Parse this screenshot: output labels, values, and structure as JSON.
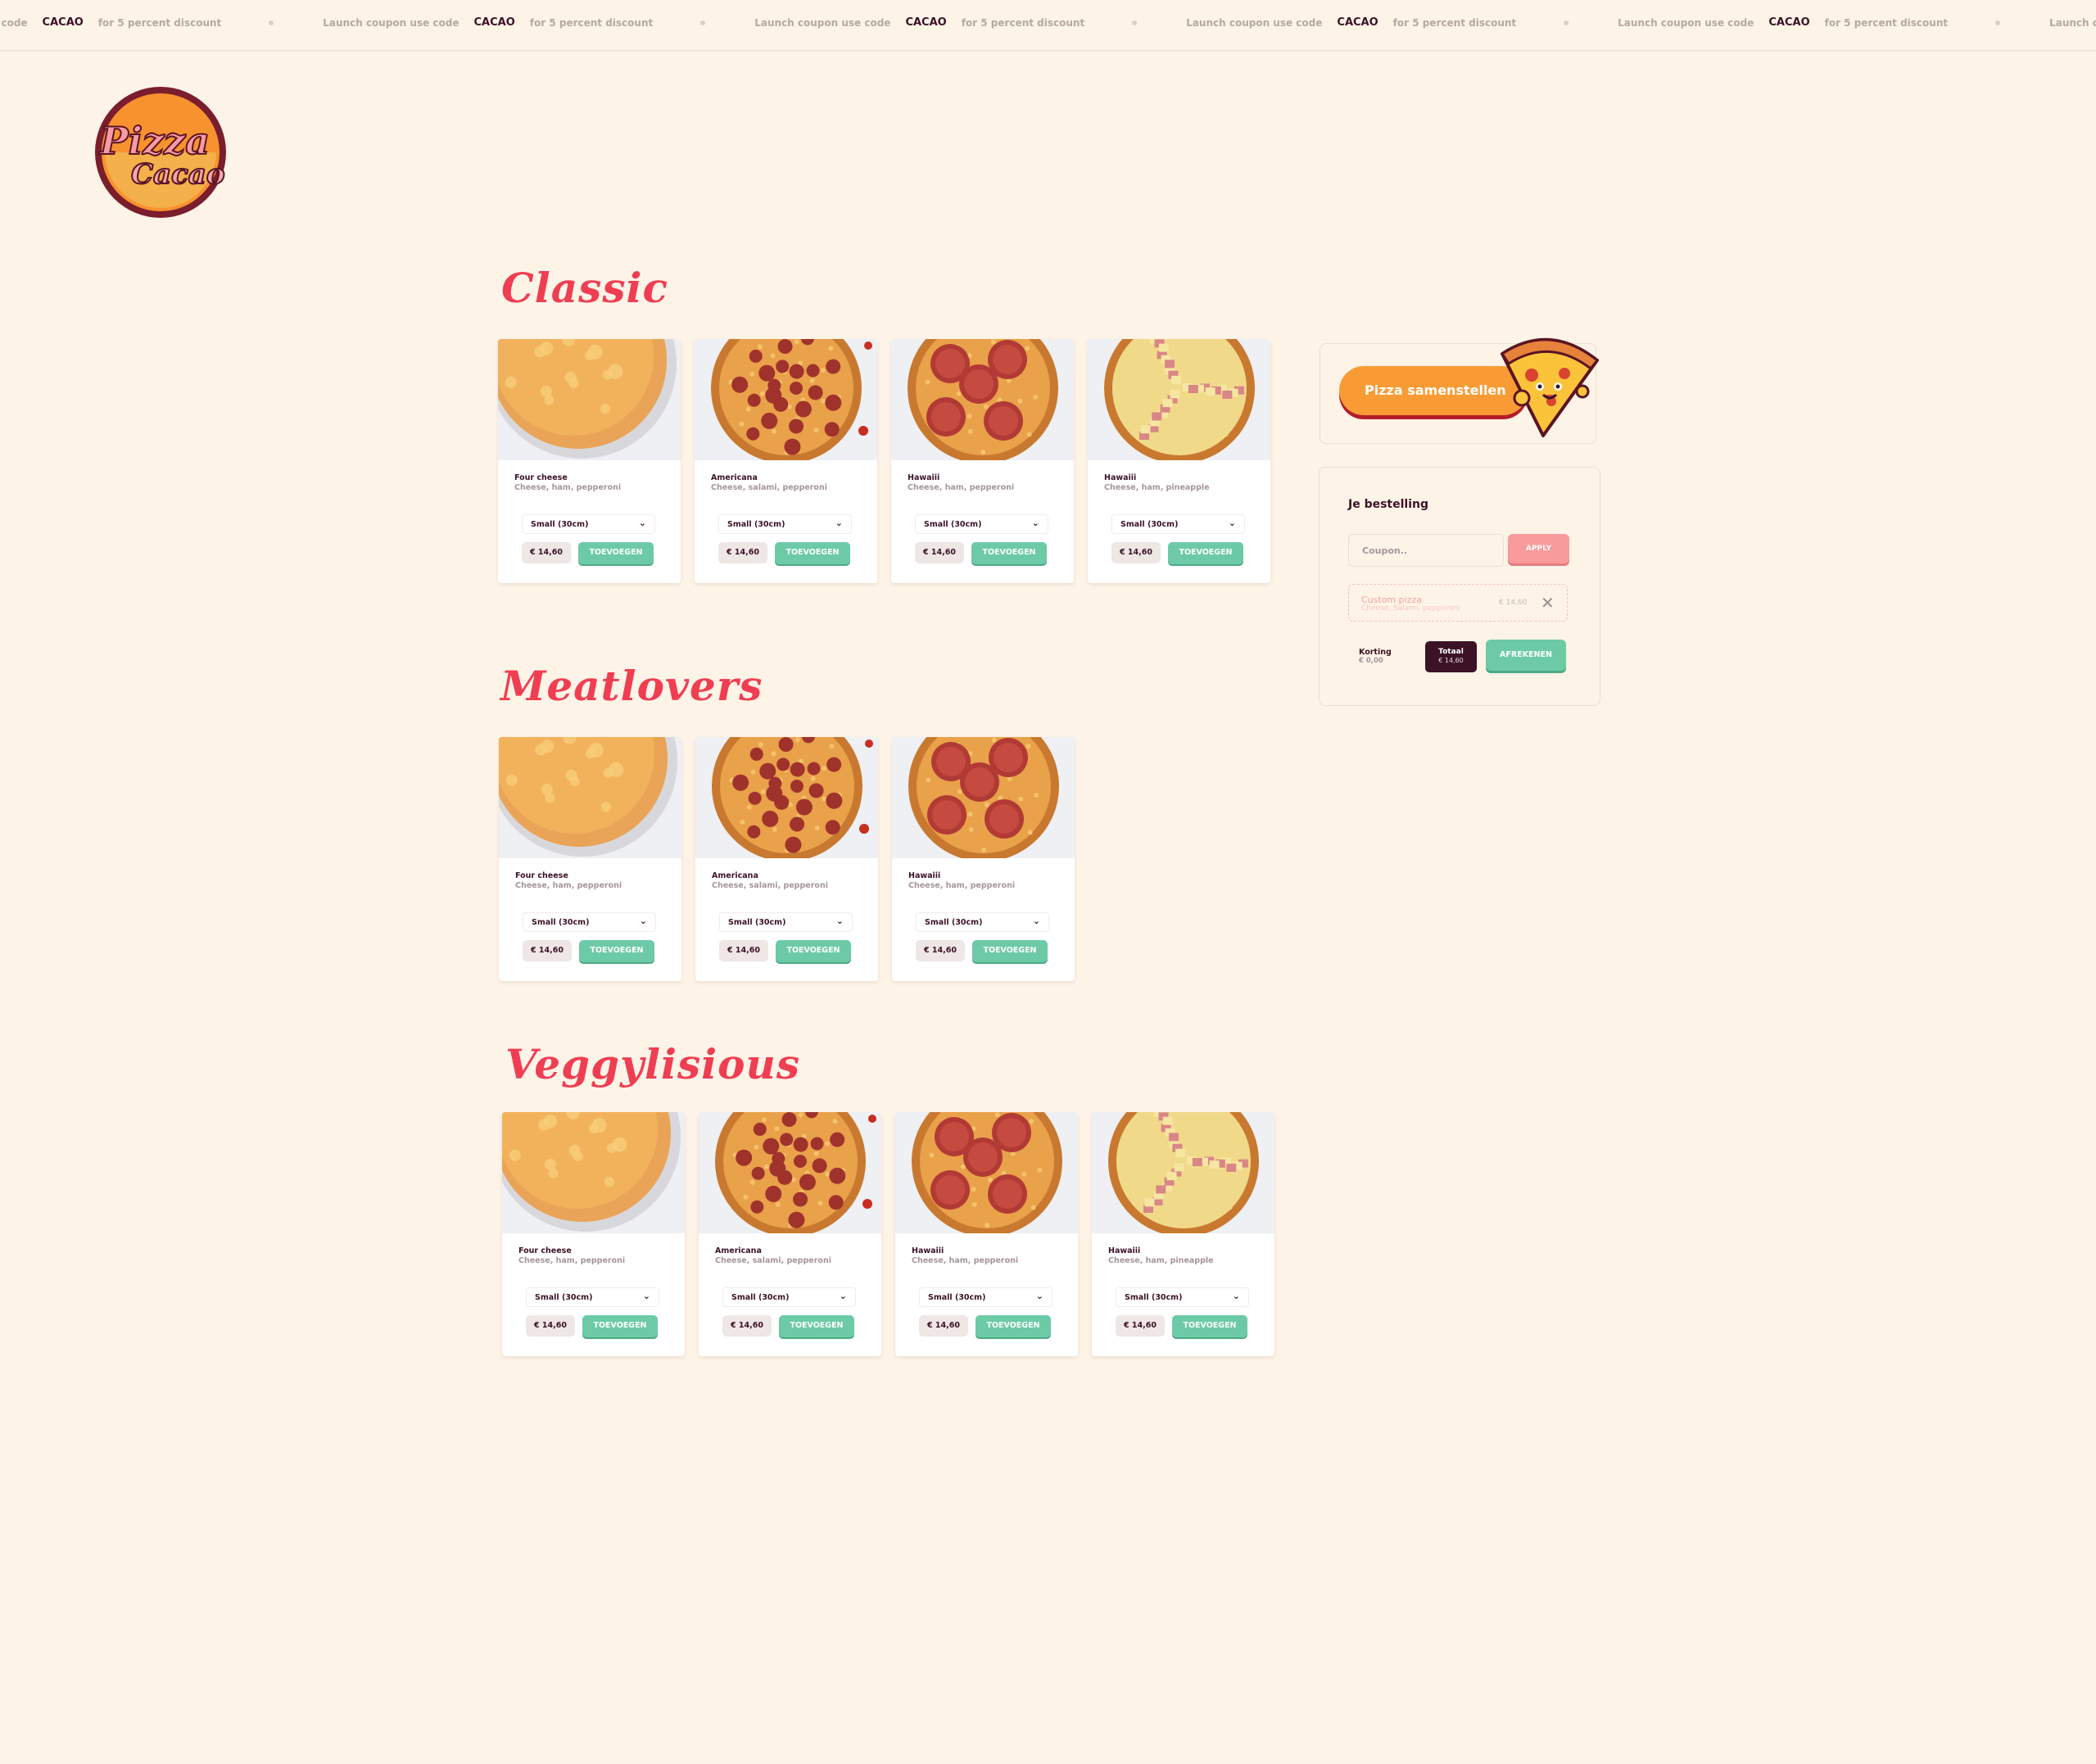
{
  "ticker": {
    "segments": [
      {
        "prefix": "coupon use code",
        "code": "CACAO",
        "suffix": "for 5 percent discount"
      },
      {
        "prefix": "Launch coupon use code",
        "code": "CACAO",
        "suffix": "for 5 percent discount"
      },
      {
        "prefix": "Launch coupon use code",
        "code": "CACAO",
        "suffix": "for 5 percent discount"
      },
      {
        "prefix": "Launch coupon use code",
        "code": "CACAO",
        "suffix": "for 5 percent discount"
      },
      {
        "prefix": "Launch coupon use code",
        "code": "CACAO",
        "suffix": "for 5 percent discount"
      },
      {
        "prefix": "Launch coupon use code",
        "code": "",
        "suffix": ""
      }
    ]
  },
  "brand": {
    "logo_line1": "Pizza",
    "logo_line2": "Cacao"
  },
  "sections": [
    {
      "title": "Classic",
      "items": [
        {
          "name": "Four cheese",
          "desc": "Cheese, ham, pepperoni",
          "size": "Small (30cm)",
          "price": "€ 14,60",
          "add": "TOEVOEGEN",
          "image": "four-cheese"
        },
        {
          "name": "Americana",
          "desc": "Cheese, salami, pepperoni",
          "size": "Small (30cm)",
          "price": "€ 14,60",
          "add": "TOEVOEGEN",
          "image": "americana"
        },
        {
          "name": "Hawaiii",
          "desc": "Cheese, ham, pepperoni",
          "size": "Small (30cm)",
          "price": "€ 14,60",
          "add": "TOEVOEGEN",
          "image": "pepperoni"
        },
        {
          "name": "Hawaiii",
          "desc": "Cheese, ham, pineapple",
          "size": "Small (30cm)",
          "price": "€ 14,60",
          "add": "TOEVOEGEN",
          "image": "hawaii"
        }
      ]
    },
    {
      "title": "Meatlovers",
      "items": [
        {
          "name": "Four cheese",
          "desc": "Cheese, ham, pepperoni",
          "size": "Small (30cm)",
          "price": "€ 14,60",
          "add": "TOEVOEGEN",
          "image": "four-cheese"
        },
        {
          "name": "Americana",
          "desc": "Cheese, salami, pepperoni",
          "size": "Small (30cm)",
          "price": "€ 14,60",
          "add": "TOEVOEGEN",
          "image": "americana"
        },
        {
          "name": "Hawaiii",
          "desc": "Cheese, ham, pepperoni",
          "size": "Small (30cm)",
          "price": "€ 14,60",
          "add": "TOEVOEGEN",
          "image": "pepperoni"
        }
      ]
    },
    {
      "title": "Veggylisious",
      "items": [
        {
          "name": "Four cheese",
          "desc": "Cheese, ham, pepperoni",
          "size": "Small (30cm)",
          "price": "€ 14,60",
          "add": "TOEVOEGEN",
          "image": "four-cheese"
        },
        {
          "name": "Americana",
          "desc": "Cheese, salami, pepperoni",
          "size": "Small (30cm)",
          "price": "€ 14,60",
          "add": "TOEVOEGEN",
          "image": "americana"
        },
        {
          "name": "Hawaiii",
          "desc": "Cheese, ham, pepperoni",
          "size": "Small (30cm)",
          "price": "€ 14,60",
          "add": "TOEVOEGEN",
          "image": "pepperoni"
        },
        {
          "name": "Hawaiii",
          "desc": "Cheese, ham, pineapple",
          "size": "Small (30cm)",
          "price": "€ 14,60",
          "add": "TOEVOEGEN",
          "image": "hawaii"
        }
      ]
    }
  ],
  "builder": {
    "button_label": "Pizza samenstellen",
    "mascot_icon": "pizza-slice-mascot-icon"
  },
  "order": {
    "title": "Je bestelling",
    "coupon_placeholder": "Coupon..",
    "apply_label": "APPLY",
    "items": [
      {
        "name": "Custom pizza",
        "desc": "Cheese, Salami, pepperoni",
        "price": "€ 14,60"
      }
    ],
    "discount_label": "Korting",
    "discount_value": "€ 0,00",
    "total_label": "Totaal",
    "total_value": "€ 14,60",
    "checkout_label": "AFREKENEN"
  },
  "colors": {
    "background": "#fdf3e7",
    "accent_red": "#ef3e52",
    "primary_green": "#6ccaa7",
    "dark_plum": "#3b1226",
    "orange": "#f99b35",
    "coupon_pink": "#f99a9c"
  }
}
